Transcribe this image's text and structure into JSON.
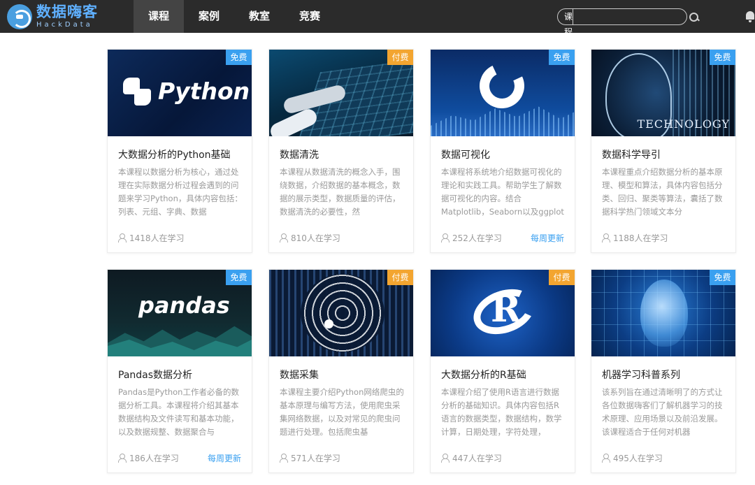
{
  "header": {
    "logo_cn": "数据嗨客",
    "logo_en": "HackData",
    "nav": [
      {
        "label": "课程",
        "active": true
      },
      {
        "label": "案例",
        "active": false
      },
      {
        "label": "教室",
        "active": false
      },
      {
        "label": "竞赛",
        "active": false
      }
    ],
    "search": {
      "category": "课程",
      "value": ""
    }
  },
  "colors": {
    "free_badge": "#3aa0f0",
    "paid_badge": "#f3a530",
    "weekly_update": "#3aa0f0",
    "topbar": "#2b2b2b"
  },
  "courses": [
    {
      "title": "大数据分析的Python基础",
      "badge": "免费",
      "badge_type": "free",
      "thumb": "python-logo",
      "desc": "本课程以数据分析为核心，通过处理在实际数据分析过程会遇到的问题来学习Python，具体内容包括：列表、元组、字典、数据",
      "learners": "1418人在学习",
      "weekly": ""
    },
    {
      "title": "数据清洗",
      "badge": "付费",
      "badge_type": "paid",
      "thumb": "hands-on-screen",
      "desc": "本课程从数据清洗的概念入手，围绕数据，介绍数据的基本概念，数据的展示类型，数据质量的评估，数据清洗的必要性，然",
      "learners": "810人在学习",
      "weekly": ""
    },
    {
      "title": "数据可视化",
      "badge": "免费",
      "badge_type": "free",
      "thumb": "donut-chart",
      "desc": "本课程将系统地介绍数据可视化的理论和实践工具。帮助学生了解数据可视化的内容。结合Matplotlib，Seaborn以及ggplot等工",
      "learners": "252人在学习",
      "weekly": "每周更新"
    },
    {
      "title": "数据科学导引",
      "badge": "免费",
      "badge_type": "free",
      "thumb": "technology-head",
      "desc": "本课程重点介绍数据分析的基本原理、模型和算法，具体内容包括分类、回归、聚类等算法，囊括了数据科学热门领域文本分",
      "learners": "1188人在学习",
      "weekly": "",
      "thumb_text": "TECHNOLOGY"
    },
    {
      "title": "Pandas数据分析",
      "badge": "免费",
      "badge_type": "free",
      "thumb": "pandas-word",
      "desc": "Pandas是Python工作者必备的数据分析工具。本课程将介绍其基本数据结构及文件读写和基本功能，以及数据规整、数据聚合与",
      "learners": "186人在学习",
      "weekly": "每周更新",
      "thumb_text": "pandas"
    },
    {
      "title": "数据采集",
      "badge": "付费",
      "badge_type": "paid",
      "thumb": "spider-web",
      "desc": "本课程主要介绍Python网络爬虫的基本原理与编写方法，使用爬虫采集网络数据，以及对常见的爬虫问题进行处理。包括爬虫基",
      "learners": "571人在学习",
      "weekly": ""
    },
    {
      "title": "大数据分析的R基础",
      "badge": "付费",
      "badge_type": "paid",
      "thumb": "r-logo",
      "desc": "本课程介绍了使用R语言进行数据分析的基础知识。具体内容包括R语言的数据类型，数据结构，数学计算，日期处理，字符处理，",
      "learners": "447人在学习",
      "weekly": "",
      "thumb_text": "R"
    },
    {
      "title": "机器学习科普系列",
      "badge": "免费",
      "badge_type": "free",
      "thumb": "ai-face",
      "desc": "该系列旨在通过清晰明了的方式让各位数据嗨客们了解机器学习的技术原理、应用场景以及前沿发展。该课程适合于任何对机器",
      "learners": "495人在学习",
      "weekly": ""
    }
  ]
}
